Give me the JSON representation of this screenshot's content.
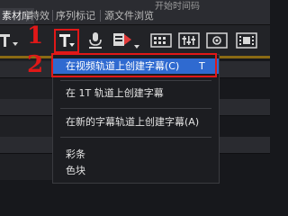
{
  "tabs": [
    {
      "label": "素材库",
      "active": true
    },
    {
      "label": "特效",
      "active": false
    },
    {
      "label": "序列标记",
      "active": false
    },
    {
      "label": "源文件浏览",
      "active": false
    }
  ],
  "timecode_header": "开始时间码",
  "annotations": {
    "step1": "1",
    "step2": "2"
  },
  "toolbar": {
    "icons": [
      "dropdown-t-icon",
      "title-t-icon",
      "voiceover-icon",
      "clip-marker-icon",
      "grid-view-icon",
      "mixer-icon",
      "settings-grid-icon",
      "film-icon"
    ]
  },
  "menu": {
    "items": [
      {
        "label": "在视频轨道上创建字幕(C)",
        "shortcut": "T",
        "highlighted": true
      },
      {
        "label": "在 1T 轨道上创建字幕",
        "shortcut": "",
        "highlighted": false
      },
      {
        "label": "在新的字幕轨道上创建字幕(A)",
        "shortcut": "",
        "highlighted": false
      },
      {
        "label": "彩条",
        "shortcut": "",
        "highlighted": false
      },
      {
        "label": "色块",
        "shortcut": "",
        "highlighted": false
      }
    ]
  },
  "colors": {
    "accent": "#2f6ad0",
    "annotation_red": "#e01818",
    "background": "#17181c"
  }
}
